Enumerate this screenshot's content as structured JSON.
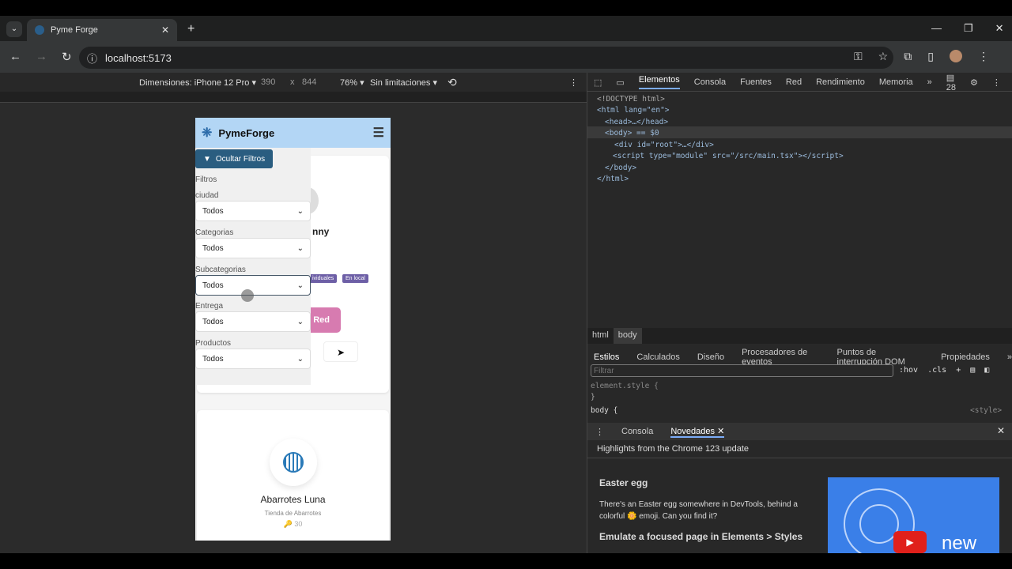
{
  "browser": {
    "tab_title": "Pyme Forge",
    "url": "localhost:5173"
  },
  "device_toolbar": {
    "device": "Dimensiones: iPhone 12 Pro",
    "width": "390",
    "x": "x",
    "height": "844",
    "zoom": "76%",
    "throttle": "Sin limitaciones"
  },
  "app": {
    "brand": "PymeForge",
    "toggle_filters": "Ocultar Filtros",
    "filters_title": "Filtros",
    "filters": [
      {
        "label": "ciudad",
        "value": "Todos"
      },
      {
        "label": "Categorias",
        "value": "Todos"
      },
      {
        "label": "Subcategorias",
        "value": "Todos"
      },
      {
        "label": "Entrega",
        "value": "Todos"
      },
      {
        "label": "Productos",
        "value": "Todos"
      }
    ],
    "card1": {
      "name_partial": "nny",
      "tags": [
        "ividuales",
        "En local"
      ],
      "button_partial": "Red"
    },
    "card2": {
      "name": "Abarrotes Luna",
      "category": "Tienda de Abarrotes",
      "count": "30"
    }
  },
  "devtools": {
    "tabs": [
      "Elementos",
      "Consola",
      "Fuentes",
      "Red",
      "Rendimiento",
      "Memoria"
    ],
    "issues": "28",
    "dom": [
      "<!DOCTYPE html>",
      "<html lang=\"en\">",
      "<head>…</head>",
      "<body> == $0",
      "<div id=\"root\">…</div>",
      "<script type=\"module\" src=\"/src/main.tsx\"></script>",
      "</body>",
      "</html>"
    ],
    "breadcrumbs": [
      "html",
      "body"
    ],
    "style_tabs": [
      "Estilos",
      "Calculados",
      "Diseño",
      "Procesadores de eventos",
      "Puntos de interrupción DOM",
      "Propiedades"
    ],
    "filter_placeholder": "Filtrar",
    "hov": ":hov",
    "cls": ".cls",
    "element_style": "element.style {",
    "close_brace": "}",
    "body_rule": "body {",
    "style_source": "<style>",
    "drawer_tabs": [
      "Consola",
      "Novedades"
    ],
    "whats_new": {
      "header": "Highlights from the Chrome 123 update",
      "h1": "Easter egg",
      "p1": "There's an Easter egg somewhere in DevTools, behind a colorful 🌼 emoji. Can you find it?",
      "h2": "Emulate a focused page in Elements > Styles",
      "video_label": "new"
    }
  }
}
